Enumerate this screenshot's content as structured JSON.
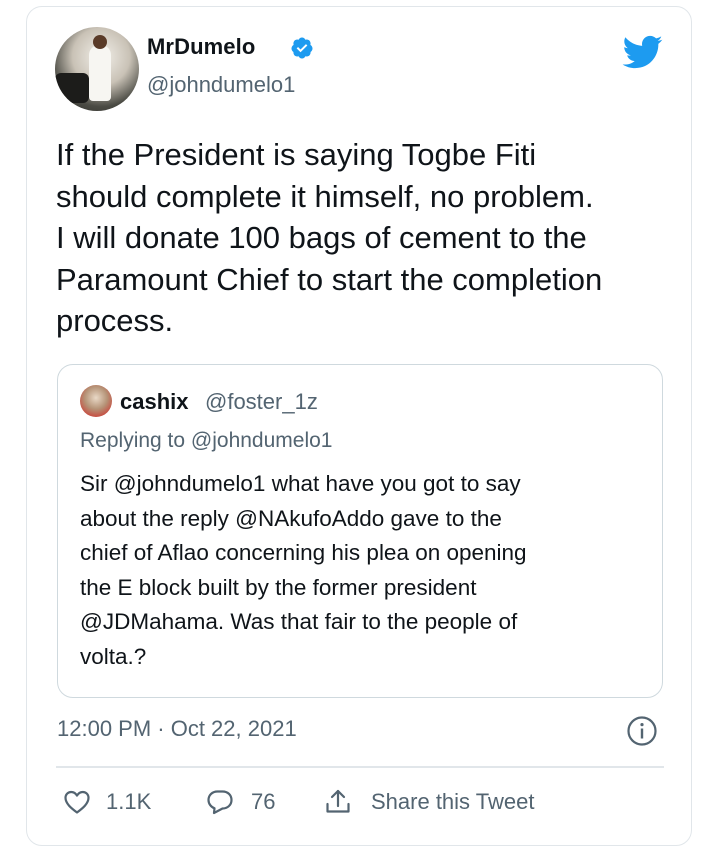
{
  "author": {
    "display_name": "MrDumelo",
    "handle": "@johndumelo1",
    "verified": true
  },
  "tweet": {
    "lines": [
      "If the President is saying Togbe Fiti",
      "should complete it himself, no problem.",
      "I will donate 100 bags of cement to the",
      "Paramount Chief to start the completion",
      "process."
    ]
  },
  "quoted": {
    "display_name": "cashix",
    "handle": "@foster_1z",
    "replying_to_label": "Replying to",
    "replying_to_handle": "@johndumelo1",
    "lines": [
      "Sir @johndumelo1 what have you got to say",
      "about the reply @NAkufoAddo gave to the",
      "chief of Aflao concerning his plea on opening",
      "the E block built by the former president",
      "@JDMahama. Was that fair to the people of",
      "volta.?"
    ]
  },
  "meta": {
    "timestamp": "12:00 PM · Oct 22, 2021"
  },
  "actions": {
    "likes": "1.1K",
    "replies": "76",
    "share_label": "Share this Tweet"
  },
  "colors": {
    "twitter_blue": "#1d9bf0",
    "secondary_text": "#536471",
    "border": "#cfd9de"
  },
  "icons": [
    "verified-badge-icon",
    "twitter-bird-icon",
    "info-icon",
    "heart-icon",
    "reply-bubble-icon",
    "share-icon"
  ]
}
